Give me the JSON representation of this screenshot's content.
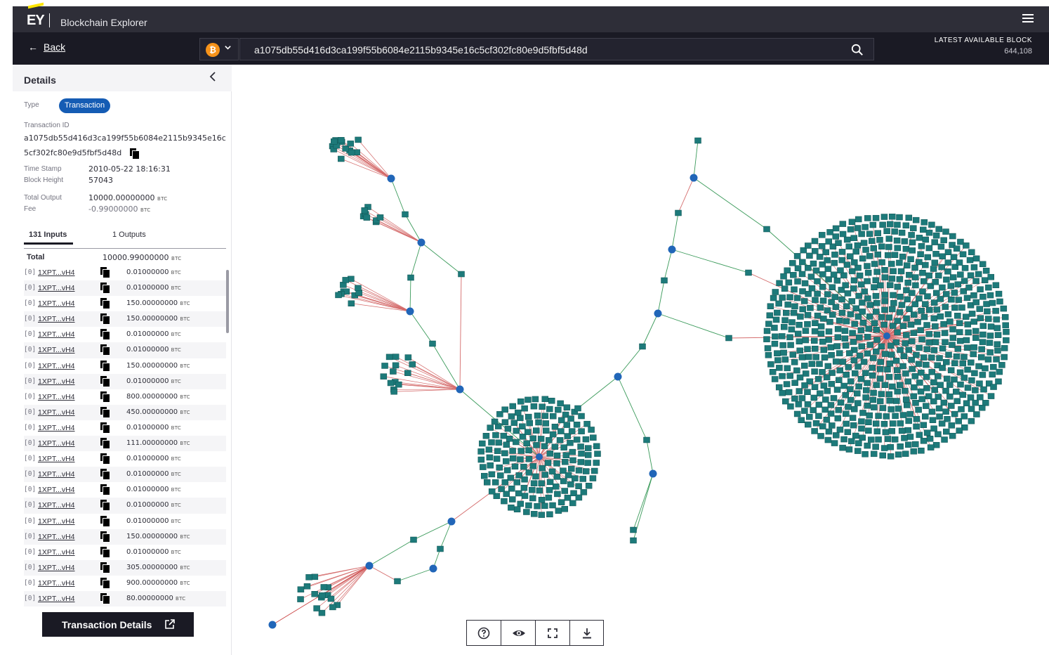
{
  "app": {
    "logo": "EY",
    "title": "Blockchain Explorer"
  },
  "nav": {
    "back_label": "Back",
    "back_arrow": "←",
    "currency_symbol": "₿",
    "search_value": "a1075db55d416d3ca199f55b6084e2115b9345e16c5cf302fc80e9d5fbf5d48d",
    "latest_block_label": "LATEST AVAILABLE BLOCK",
    "latest_block_value": "644,108"
  },
  "details": {
    "title": "Details",
    "type_label": "Type",
    "type_value": "Transaction",
    "txid_label": "Transaction ID",
    "txid_value": "a1075db55d416d3ca199f55b6084e2115b9345e16c5cf302fc80e9d5fbf5d48d",
    "timestamp_label": "Time Stamp",
    "timestamp_value": "2010-05-22 18:16:31",
    "block_height_label": "Block Height",
    "block_height_value": "57043",
    "total_output_label": "Total Output",
    "total_output_value": "10000.00000000",
    "fee_label": "Fee",
    "fee_value": "-0.99000000",
    "unit": "BTC",
    "tab_inputs": "131 Inputs",
    "tab_outputs": "1 Outputs",
    "total_label": "Total",
    "total_value": "10000.99000000",
    "inputs": [
      {
        "index": "[0]",
        "address": "1XPT...vH4",
        "amount": "0.01000000"
      },
      {
        "index": "[0]",
        "address": "1XPT...vH4",
        "amount": "0.01000000"
      },
      {
        "index": "[0]",
        "address": "1XPT...vH4",
        "amount": "150.00000000"
      },
      {
        "index": "[0]",
        "address": "1XPT...vH4",
        "amount": "150.00000000"
      },
      {
        "index": "[0]",
        "address": "1XPT...vH4",
        "amount": "0.01000000"
      },
      {
        "index": "[0]",
        "address": "1XPT...vH4",
        "amount": "0.01000000"
      },
      {
        "index": "[0]",
        "address": "1XPT...vH4",
        "amount": "150.00000000"
      },
      {
        "index": "[0]",
        "address": "1XPT...vH4",
        "amount": "0.01000000"
      },
      {
        "index": "[0]",
        "address": "1XPT...vH4",
        "amount": "800.00000000"
      },
      {
        "index": "[0]",
        "address": "1XPT...vH4",
        "amount": "450.00000000"
      },
      {
        "index": "[0]",
        "address": "1XPT...vH4",
        "amount": "0.01000000"
      },
      {
        "index": "[0]",
        "address": "1XPT...vH4",
        "amount": "111.00000000"
      },
      {
        "index": "[0]",
        "address": "1XPT...vH4",
        "amount": "0.01000000"
      },
      {
        "index": "[0]",
        "address": "1XPT...vH4",
        "amount": "0.01000000"
      },
      {
        "index": "[0]",
        "address": "1XPT...vH4",
        "amount": "0.01000000"
      },
      {
        "index": "[0]",
        "address": "1XPT...vH4",
        "amount": "0.01000000"
      },
      {
        "index": "[0]",
        "address": "1XPT...vH4",
        "amount": "0.01000000"
      },
      {
        "index": "[0]",
        "address": "1XPT...vH4",
        "amount": "150.00000000"
      },
      {
        "index": "[0]",
        "address": "1XPT...vH4",
        "amount": "0.01000000"
      },
      {
        "index": "[0]",
        "address": "1XPT...vH4",
        "amount": "305.00000000"
      },
      {
        "index": "[0]",
        "address": "1XPT...vH4",
        "amount": "900.00000000"
      },
      {
        "index": "[0]",
        "address": "1XPT...vH4",
        "amount": "80.00000000"
      }
    ],
    "tx_details_button": "Transaction Details"
  },
  "toolbar": {
    "items": [
      "help-icon",
      "eye-icon",
      "fullscreen-icon",
      "download-icon"
    ]
  },
  "colors": {
    "header_bg": "#2e2e38",
    "nav_bg": "#1a1a24",
    "pill": "#155cb4",
    "node": "#1d7a7a",
    "tx_node": "#2166b8",
    "edge_in": "#d46a6a",
    "edge_out": "#3a9a5a",
    "brand_yellow": "#ffe600"
  }
}
